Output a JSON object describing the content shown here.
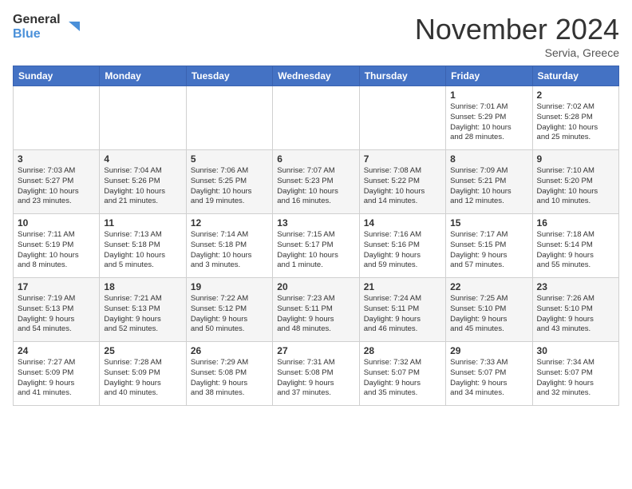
{
  "header": {
    "logo_line1": "General",
    "logo_line2": "Blue",
    "month": "November 2024",
    "location": "Servia, Greece"
  },
  "weekdays": [
    "Sunday",
    "Monday",
    "Tuesday",
    "Wednesday",
    "Thursday",
    "Friday",
    "Saturday"
  ],
  "weeks": [
    [
      {
        "day": "",
        "info": ""
      },
      {
        "day": "",
        "info": ""
      },
      {
        "day": "",
        "info": ""
      },
      {
        "day": "",
        "info": ""
      },
      {
        "day": "",
        "info": ""
      },
      {
        "day": "1",
        "info": "Sunrise: 7:01 AM\nSunset: 5:29 PM\nDaylight: 10 hours\nand 28 minutes."
      },
      {
        "day": "2",
        "info": "Sunrise: 7:02 AM\nSunset: 5:28 PM\nDaylight: 10 hours\nand 25 minutes."
      }
    ],
    [
      {
        "day": "3",
        "info": "Sunrise: 7:03 AM\nSunset: 5:27 PM\nDaylight: 10 hours\nand 23 minutes."
      },
      {
        "day": "4",
        "info": "Sunrise: 7:04 AM\nSunset: 5:26 PM\nDaylight: 10 hours\nand 21 minutes."
      },
      {
        "day": "5",
        "info": "Sunrise: 7:06 AM\nSunset: 5:25 PM\nDaylight: 10 hours\nand 19 minutes."
      },
      {
        "day": "6",
        "info": "Sunrise: 7:07 AM\nSunset: 5:23 PM\nDaylight: 10 hours\nand 16 minutes."
      },
      {
        "day": "7",
        "info": "Sunrise: 7:08 AM\nSunset: 5:22 PM\nDaylight: 10 hours\nand 14 minutes."
      },
      {
        "day": "8",
        "info": "Sunrise: 7:09 AM\nSunset: 5:21 PM\nDaylight: 10 hours\nand 12 minutes."
      },
      {
        "day": "9",
        "info": "Sunrise: 7:10 AM\nSunset: 5:20 PM\nDaylight: 10 hours\nand 10 minutes."
      }
    ],
    [
      {
        "day": "10",
        "info": "Sunrise: 7:11 AM\nSunset: 5:19 PM\nDaylight: 10 hours\nand 8 minutes."
      },
      {
        "day": "11",
        "info": "Sunrise: 7:13 AM\nSunset: 5:18 PM\nDaylight: 10 hours\nand 5 minutes."
      },
      {
        "day": "12",
        "info": "Sunrise: 7:14 AM\nSunset: 5:18 PM\nDaylight: 10 hours\nand 3 minutes."
      },
      {
        "day": "13",
        "info": "Sunrise: 7:15 AM\nSunset: 5:17 PM\nDaylight: 10 hours\nand 1 minute."
      },
      {
        "day": "14",
        "info": "Sunrise: 7:16 AM\nSunset: 5:16 PM\nDaylight: 9 hours\nand 59 minutes."
      },
      {
        "day": "15",
        "info": "Sunrise: 7:17 AM\nSunset: 5:15 PM\nDaylight: 9 hours\nand 57 minutes."
      },
      {
        "day": "16",
        "info": "Sunrise: 7:18 AM\nSunset: 5:14 PM\nDaylight: 9 hours\nand 55 minutes."
      }
    ],
    [
      {
        "day": "17",
        "info": "Sunrise: 7:19 AM\nSunset: 5:13 PM\nDaylight: 9 hours\nand 54 minutes."
      },
      {
        "day": "18",
        "info": "Sunrise: 7:21 AM\nSunset: 5:13 PM\nDaylight: 9 hours\nand 52 minutes."
      },
      {
        "day": "19",
        "info": "Sunrise: 7:22 AM\nSunset: 5:12 PM\nDaylight: 9 hours\nand 50 minutes."
      },
      {
        "day": "20",
        "info": "Sunrise: 7:23 AM\nSunset: 5:11 PM\nDaylight: 9 hours\nand 48 minutes."
      },
      {
        "day": "21",
        "info": "Sunrise: 7:24 AM\nSunset: 5:11 PM\nDaylight: 9 hours\nand 46 minutes."
      },
      {
        "day": "22",
        "info": "Sunrise: 7:25 AM\nSunset: 5:10 PM\nDaylight: 9 hours\nand 45 minutes."
      },
      {
        "day": "23",
        "info": "Sunrise: 7:26 AM\nSunset: 5:10 PM\nDaylight: 9 hours\nand 43 minutes."
      }
    ],
    [
      {
        "day": "24",
        "info": "Sunrise: 7:27 AM\nSunset: 5:09 PM\nDaylight: 9 hours\nand 41 minutes."
      },
      {
        "day": "25",
        "info": "Sunrise: 7:28 AM\nSunset: 5:09 PM\nDaylight: 9 hours\nand 40 minutes."
      },
      {
        "day": "26",
        "info": "Sunrise: 7:29 AM\nSunset: 5:08 PM\nDaylight: 9 hours\nand 38 minutes."
      },
      {
        "day": "27",
        "info": "Sunrise: 7:31 AM\nSunset: 5:08 PM\nDaylight: 9 hours\nand 37 minutes."
      },
      {
        "day": "28",
        "info": "Sunrise: 7:32 AM\nSunset: 5:07 PM\nDaylight: 9 hours\nand 35 minutes."
      },
      {
        "day": "29",
        "info": "Sunrise: 7:33 AM\nSunset: 5:07 PM\nDaylight: 9 hours\nand 34 minutes."
      },
      {
        "day": "30",
        "info": "Sunrise: 7:34 AM\nSunset: 5:07 PM\nDaylight: 9 hours\nand 32 minutes."
      }
    ]
  ]
}
